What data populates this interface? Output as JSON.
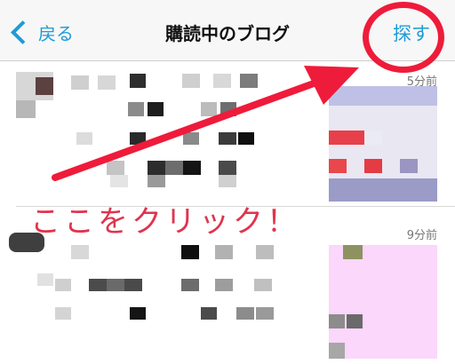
{
  "navbar": {
    "back_label": "戻る",
    "title": "購読中のブログ",
    "search_label": "探す"
  },
  "feed": {
    "items": [
      {
        "time": "5分前"
      },
      {
        "time": "9分前"
      }
    ]
  },
  "annotation": {
    "text": "ここをクリック！",
    "color": "#e0344e"
  },
  "colors": {
    "accent": "#1e9bd7",
    "highlight": "#ef1b3a"
  }
}
